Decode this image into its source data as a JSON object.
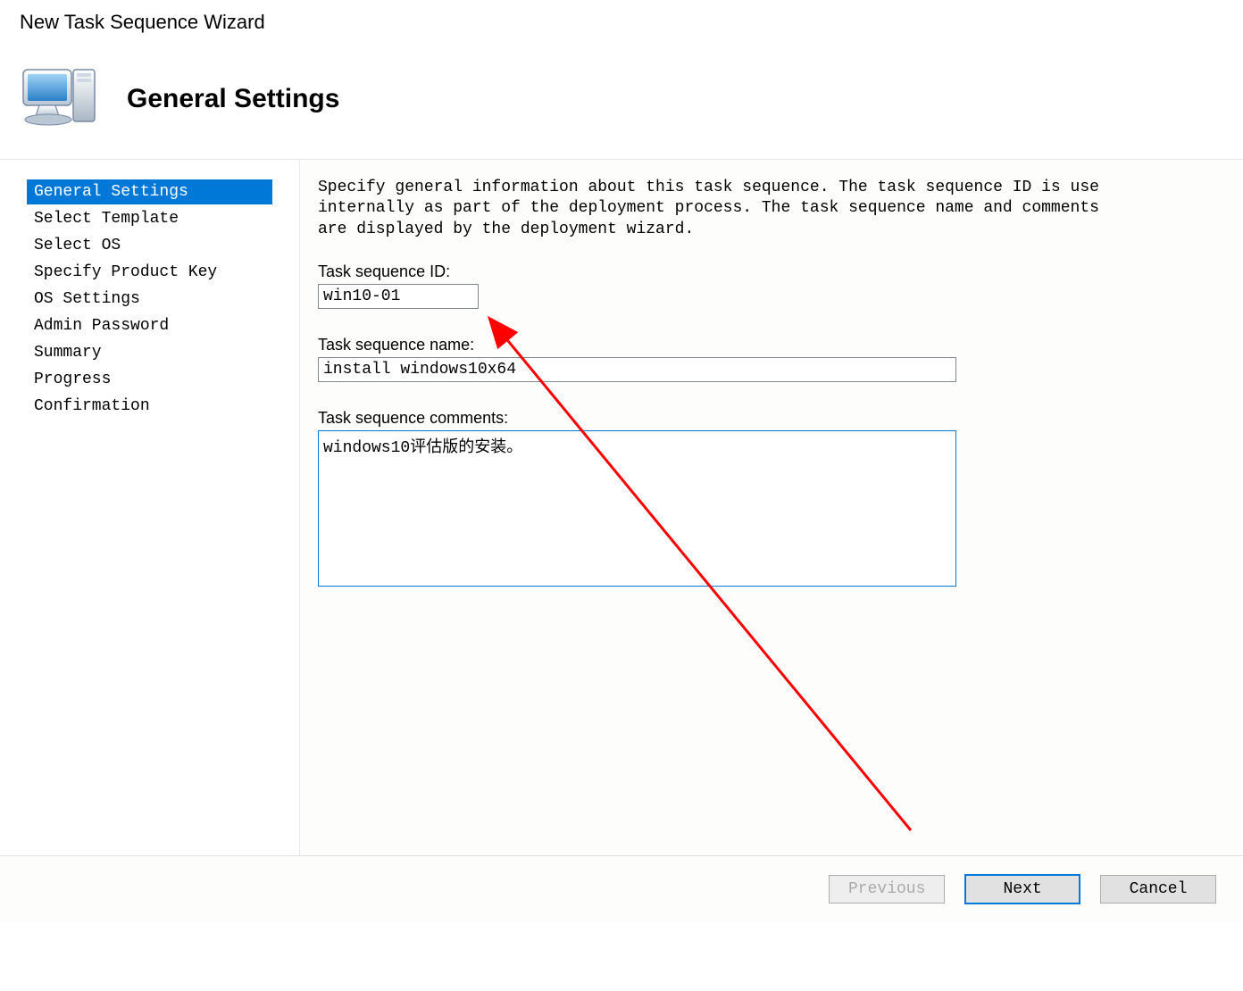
{
  "window": {
    "title": "New Task Sequence Wizard"
  },
  "header": {
    "title": "General Settings"
  },
  "sidebar": {
    "items": [
      {
        "label": "General Settings",
        "active": true
      },
      {
        "label": "Select Template",
        "active": false
      },
      {
        "label": "Select OS",
        "active": false
      },
      {
        "label": "Specify Product Key",
        "active": false
      },
      {
        "label": "OS Settings",
        "active": false
      },
      {
        "label": "Admin Password",
        "active": false
      },
      {
        "label": "Summary",
        "active": false
      },
      {
        "label": "Progress",
        "active": false
      },
      {
        "label": "Confirmation",
        "active": false
      }
    ]
  },
  "main": {
    "description": "Specify general information about this task sequence.  The task sequence ID is use\ninternally as part of the deployment process.  The task sequence name and comments\nare displayed by the deployment wizard.",
    "task_id_label": "Task sequence ID:",
    "task_id_value": "win10-01",
    "task_name_label": "Task sequence name:",
    "task_name_value": "install windows10x64",
    "comments_label": "Task sequence comments:",
    "comments_value": "windows10评估版的安装。"
  },
  "buttons": {
    "previous": "Previous",
    "next": "Next",
    "cancel": "Cancel"
  }
}
